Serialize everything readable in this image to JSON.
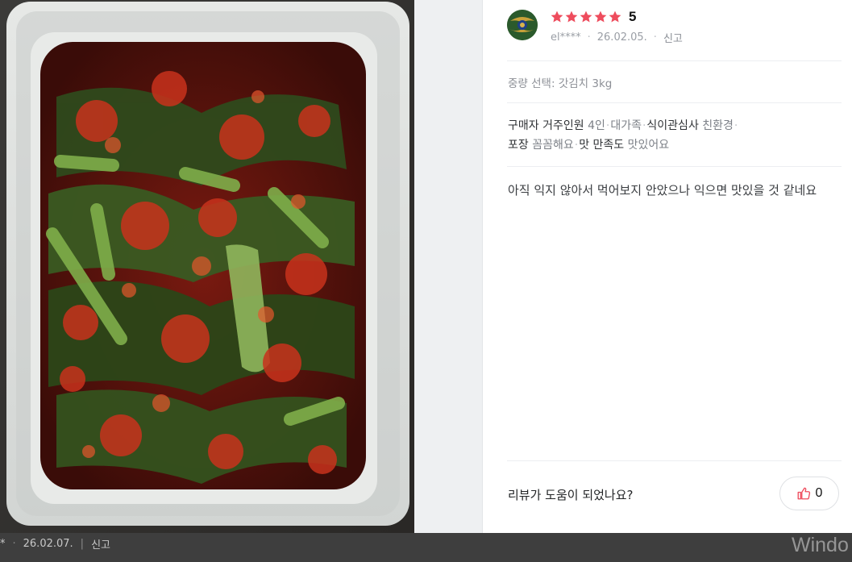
{
  "photo": {
    "alt": "Kimchi photo"
  },
  "review": {
    "avatar_icon": "user-avatar-icon",
    "rating": "5",
    "star_color": "#ee4c5d",
    "username": "el****",
    "date": "26.02.05.",
    "report_label": "신고",
    "option": "중량 선택: 갓김치 3kg",
    "tags": {
      "row1": [
        {
          "key": "구매자 거주인원",
          "value": "4인"
        },
        {
          "key": "",
          "value": "대가족"
        },
        {
          "key": "식이관심사",
          "value": "친환경"
        }
      ],
      "row2": [
        {
          "key": "포장",
          "value": "꼼꼼해요"
        },
        {
          "key": "맛 만족도",
          "value": "맛있어요"
        }
      ]
    },
    "body": "아직 익지 않아서 먹어보지 안았으나 익으면 맛있을 것 같네요",
    "helpful_question": "리뷰가 도움이 되었나요?",
    "like_icon": "thumbs-up-icon",
    "like_count": "0",
    "accent": "#ee4c5d"
  },
  "bottom": {
    "asterisk": "*",
    "date": "26.02.07.",
    "report_label": "신고",
    "watermark": "Windo"
  }
}
